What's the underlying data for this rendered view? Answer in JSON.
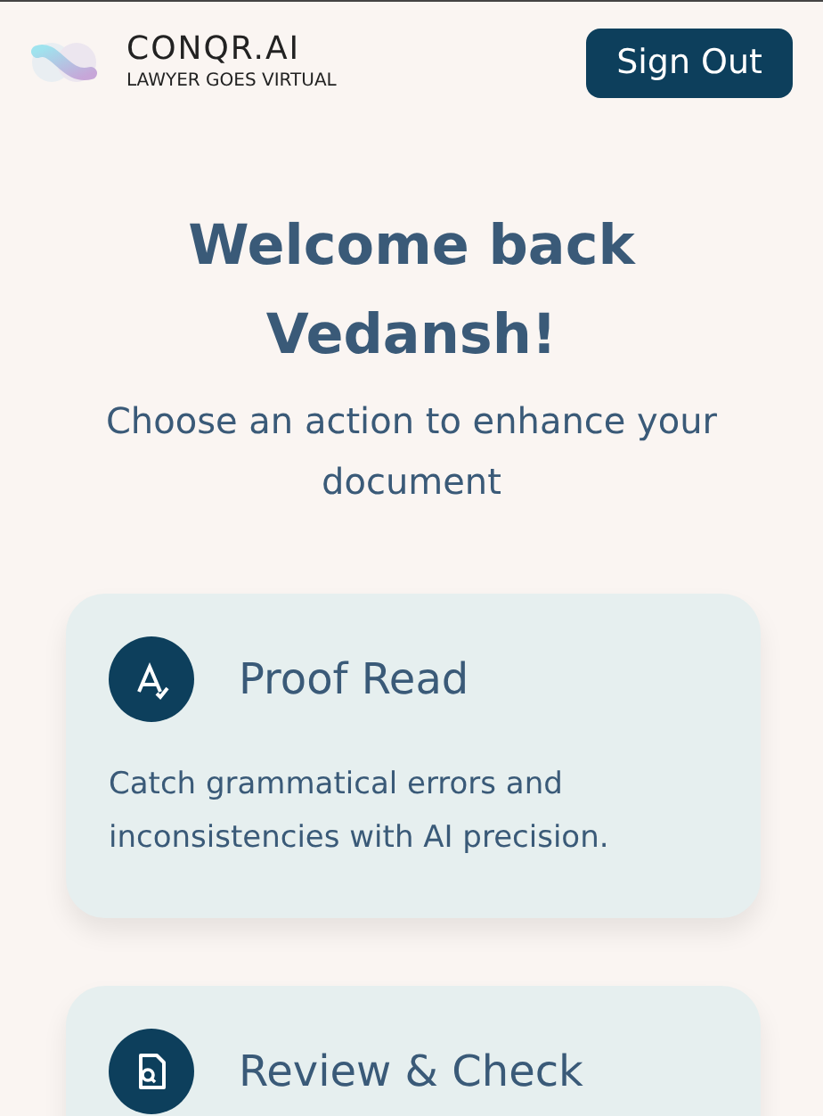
{
  "header": {
    "brand": "CONQR.AI",
    "tagline": "LAWYER GOES VIRTUAL",
    "sign_out": "Sign Out"
  },
  "welcome": {
    "title": "Welcome back Vedansh!",
    "subtitle": "Choose an action to enhance your document"
  },
  "actions": [
    {
      "kind": "proofread",
      "title": "Proof Read",
      "description": "Catch grammatical errors and inconsistencies with AI precision."
    },
    {
      "kind": "review",
      "title": "Review & Check"
    }
  ]
}
